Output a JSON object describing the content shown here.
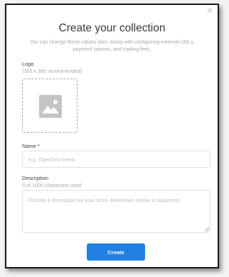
{
  "modal": {
    "title": "Create your collection",
    "subtitle": "You can change these values later, along with configuring external URLs, payment options, and trading fees.",
    "close_icon": "close-icon"
  },
  "logo": {
    "label": "Logo",
    "hint": "(350 x 350 recommended)",
    "icon": "image-placeholder-icon"
  },
  "name_field": {
    "label": "Name *",
    "placeholder": "e.g. OpenSea Gems",
    "value": ""
  },
  "description_field": {
    "label": "Description",
    "counter": "0 of 1000 characters used",
    "placeholder": "Provide a description for your store. Markdown syntax is supported.",
    "value": ""
  },
  "create_button": {
    "label": "Create"
  },
  "colors": {
    "accent": "#2081e2",
    "placeholder_icon": "#c4c4c4"
  }
}
